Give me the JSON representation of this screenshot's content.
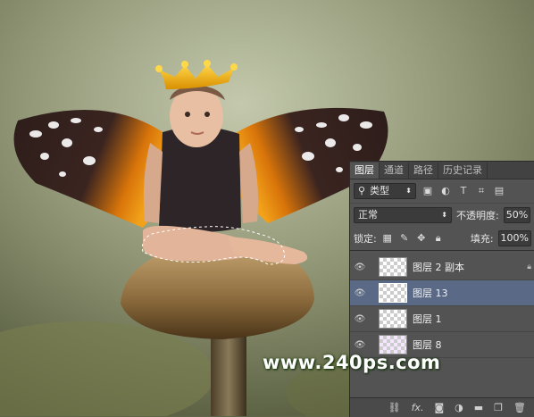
{
  "panel": {
    "tabs": [
      "图层",
      "通道",
      "路径",
      "历史记录"
    ],
    "filter_label": "类型",
    "blend_mode": "正常",
    "opacity_label": "不透明度:",
    "opacity_value": "50%",
    "lock_label": "锁定:",
    "fill_label": "填充:",
    "fill_value": "100%",
    "layers": [
      {
        "name": "图层 2 副本",
        "selected": false
      },
      {
        "name": "图层 13",
        "selected": true
      },
      {
        "name": "图层 1",
        "selected": false
      },
      {
        "name": "图层 8",
        "selected": false
      }
    ],
    "bottom_icons": [
      "link-icon",
      "fx-icon",
      "mask-icon",
      "adjustment-icon",
      "folder-icon",
      "new-layer-icon",
      "trash-icon"
    ],
    "fx_label": "fx."
  },
  "watermark": "www.240ps.com",
  "colors": {
    "selected_layer": "#5a6a86",
    "panel_bg": "#535353",
    "crown": "#f1b400"
  }
}
